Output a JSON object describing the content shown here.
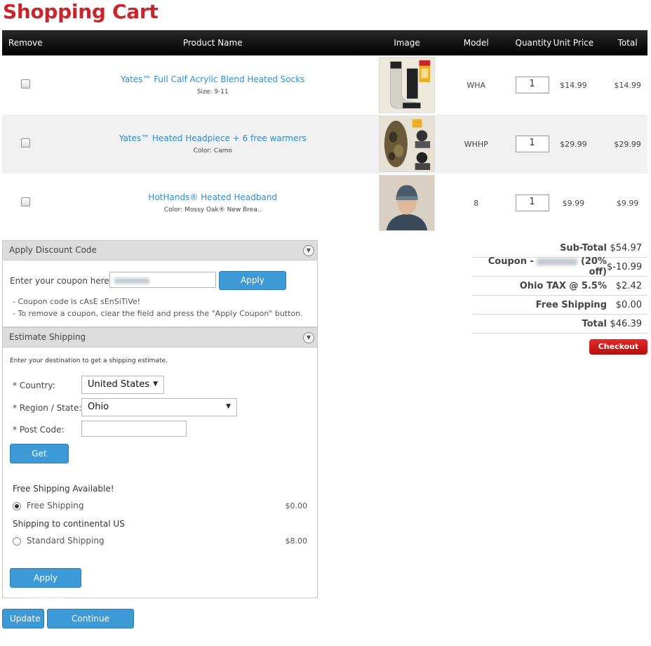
{
  "page_title": "Shopping Cart",
  "table": {
    "headers": {
      "remove": "Remove",
      "name": "Product Name",
      "image": "Image",
      "model": "Model",
      "quantity": "Quantity",
      "unit_price": "Unit Price",
      "total": "Total"
    },
    "rows": [
      {
        "name": "Yates™ Full Calf Acrylic Blend Heated Socks",
        "attr": "Size: 9-11",
        "model": "WHA",
        "quantity": "1",
        "unit_price": "$14.99",
        "total": "$14.99"
      },
      {
        "name": "Yates™ Heated Headpiece + 6 free warmers",
        "attr": "Color: Camo",
        "model": "WHHP",
        "quantity": "1",
        "unit_price": "$29.99",
        "total": "$29.99"
      },
      {
        "name": "HotHands® Heated Headband",
        "attr": "Color: Mossy Oak® New Brea..",
        "model": "8",
        "quantity": "1",
        "unit_price": "$9.99",
        "total": "$9.99"
      }
    ]
  },
  "discount": {
    "heading": "Apply Discount Code",
    "coupon_label": "Enter your coupon here:",
    "apply_button": "Apply Coupon",
    "note1": "- Coupon code is cAsE sEnSiTiVe!",
    "note2": "- To remove a coupon, clear the field and press the \"Apply Coupon\" button."
  },
  "shipping": {
    "heading": "Estimate Shipping",
    "intro": "Enter your destination to get a shipping estimate.",
    "country_label": "* Country:",
    "country_value": "United States",
    "region_label": "* Region / State:",
    "region_value": "Ohio",
    "postcode_label": "* Post Code:",
    "quotes_button": "Get Quotes",
    "group1_title": "Free Shipping Available!",
    "option1_label": "Free Shipping",
    "option1_price": "$0.00",
    "group2_title": "Shipping to continental US",
    "option2_label": "Standard Shipping",
    "option2_price": "$8.00",
    "apply_button": "Apply Shipping"
  },
  "totals": {
    "subtotal_label": "Sub-Total",
    "subtotal_value": "$54.97",
    "coupon_label_prefix": "Coupon -",
    "coupon_label_suffix": "(20% off)",
    "coupon_value": "$-10.99",
    "tax_label": "Ohio TAX @ 5.5%",
    "tax_value": "$2.42",
    "shipping_label": "Free Shipping",
    "shipping_value": "$0.00",
    "total_label": "Total",
    "total_value": "$46.39",
    "checkout_button": "Checkout"
  },
  "bottom": {
    "update_button": "Update",
    "continue_button": "Continue Shopping"
  },
  "colors": {
    "title_red": "#c8262a",
    "link_blue": "#2d8ccc",
    "button_blue": "#3d9ad6",
    "checkout_red": "#c81a1a"
  }
}
